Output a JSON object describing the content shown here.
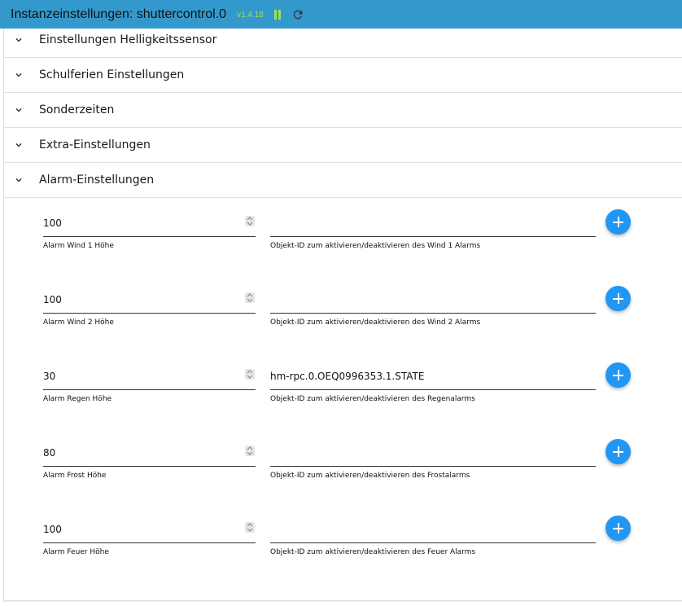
{
  "header": {
    "title": "Instanzeinstellungen: shuttercontrol.0",
    "version": "v1.4.18",
    "accent_color": "#3399cc",
    "status_color": "#9be05a"
  },
  "sections": [
    {
      "label": "Einstellungen Helligkeitssensor",
      "icon": "chevron-down-icon"
    },
    {
      "label": "Schulferien Einstellungen",
      "icon": "chevron-down-icon"
    },
    {
      "label": "Sonderzeiten",
      "icon": "chevron-down-icon"
    },
    {
      "label": "Extra-Einstellungen",
      "icon": "chevron-down-icon"
    },
    {
      "label": "Alarm-Einstellungen",
      "icon": "chevron-down-icon",
      "expanded": true
    }
  ],
  "alarms": [
    {
      "height_value": "100",
      "height_label": "Alarm Wind 1 Höhe",
      "object_id": "",
      "object_label": "Objekt-ID zum aktivieren/deaktivieren des Wind 1 Alarms"
    },
    {
      "height_value": "100",
      "height_label": "Alarm Wind 2 Höhe",
      "object_id": "",
      "object_label": "Objekt-ID zum aktivieren/deaktivieren des Wind 2 Alarms"
    },
    {
      "height_value": "30",
      "height_label": "Alarm Regen Höhe",
      "object_id": "hm-rpc.0.OEQ0996353.1.STATE",
      "object_label": "Objekt-ID zum aktivieren/deaktivieren des Regenalarms"
    },
    {
      "height_value": "80",
      "height_label": "Alarm Frost Höhe",
      "object_id": "",
      "object_label": "Objekt-ID zum aktivieren/deaktivieren des Frostalarms"
    },
    {
      "height_value": "100",
      "height_label": "Alarm Feuer Höhe",
      "object_id": "",
      "object_label": "Objekt-ID zum aktivieren/deaktivieren des Feuer Alarms"
    }
  ],
  "add_button_color": "#2196f3"
}
